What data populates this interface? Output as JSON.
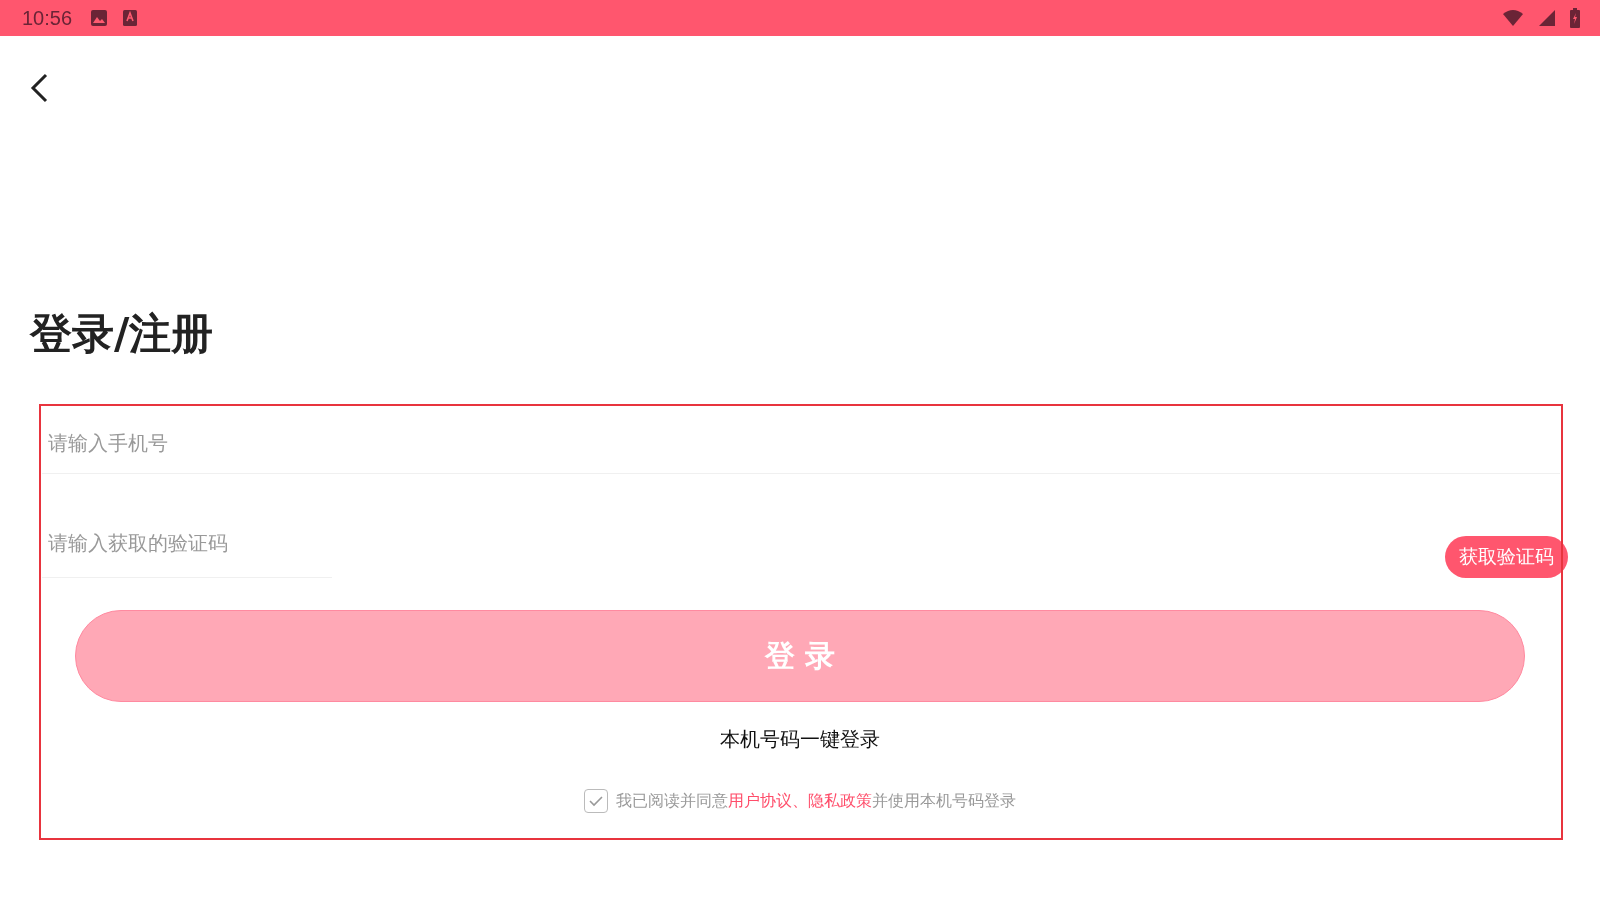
{
  "status_bar": {
    "time": "10:56"
  },
  "title": "登录/注册",
  "phone_field": {
    "placeholder": "请输入手机号"
  },
  "code_field": {
    "placeholder": "请输入获取的验证码"
  },
  "get_code_button": "获取验证码",
  "login_button": {
    "label": "登 录",
    "disabled": true
  },
  "one_tap_login": "本机号码一键登录",
  "agreement": {
    "checked": true,
    "before": "我已阅读并同意",
    "links": [
      "用户协议",
      "隐私政策"
    ],
    "separator": "、",
    "after": "并使用本机号码登录"
  }
}
